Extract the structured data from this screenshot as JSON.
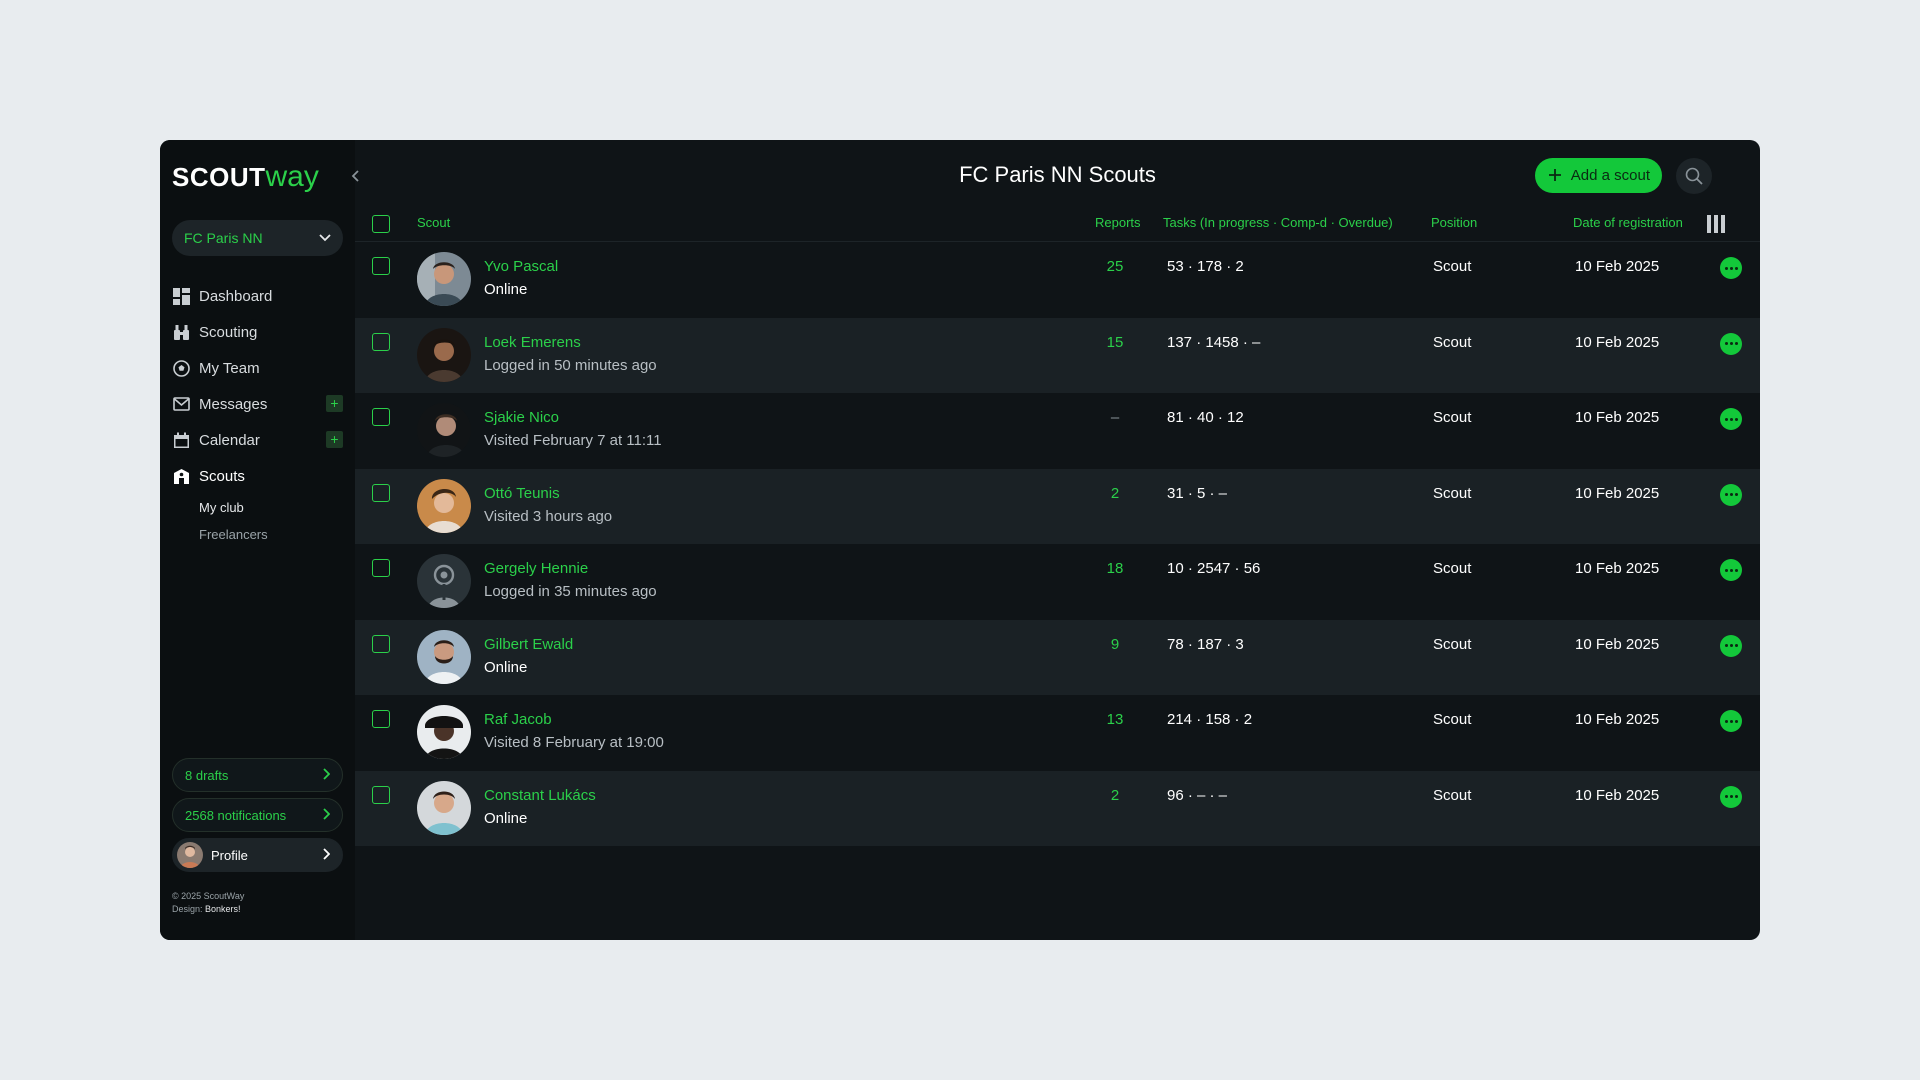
{
  "brand": {
    "logo_main": "SCOUT",
    "logo_accent": "way"
  },
  "sidebar": {
    "club": "FC Paris NN",
    "items": [
      {
        "label": "Dashboard",
        "icon": "dashboard-icon"
      },
      {
        "label": "Scouting",
        "icon": "binoculars-icon"
      },
      {
        "label": "My Team",
        "icon": "soccer-ball-icon"
      },
      {
        "label": "Messages",
        "icon": "envelope-icon"
      },
      {
        "label": "Calendar",
        "icon": "calendar-icon"
      },
      {
        "label": "Scouts",
        "icon": "scout-icon"
      }
    ],
    "sub_items": [
      "My club",
      "Freelancers"
    ],
    "drafts": "8 drafts",
    "notifications": "2568 notifications",
    "profile": "Profile",
    "copyright": "© 2025 ScoutWay",
    "design_label": "Design:",
    "design_by": "Bonkers!"
  },
  "header": {
    "title": "FC Paris NN Scouts",
    "add_button": "Add a scout"
  },
  "table": {
    "columns": {
      "scout": "Scout",
      "reports": "Reports",
      "tasks": "Tasks (In progress · Comp-d · Overdue)",
      "position": "Position",
      "date": "Date of registration"
    },
    "rows": [
      {
        "name": "Yvo Pascal",
        "status": "Online",
        "reports": "25",
        "tasks": "53 · 178 · 2",
        "position": "Scout",
        "date": "10 Feb 2025"
      },
      {
        "name": "Loek Emerens",
        "status": "Logged in 50 minutes ago",
        "reports": "15",
        "tasks": "137 · 1458 · –",
        "position": "Scout",
        "date": "10 Feb 2025"
      },
      {
        "name": "Sjakie Nico",
        "status": "Visited February 7 at 11:11",
        "reports": "–",
        "tasks": "81 · 40 · 12",
        "position": "Scout",
        "date": "10 Feb 2025"
      },
      {
        "name": "Ottó Teunis",
        "status": "Visited 3 hours ago",
        "reports": "2",
        "tasks": "31 · 5 · –",
        "position": "Scout",
        "date": "10 Feb 2025"
      },
      {
        "name": "Gergely Hennie",
        "status": "Logged in 35 minutes ago",
        "reports": "18",
        "tasks": "10 · 2547 · 56",
        "position": "Scout",
        "date": "10 Feb 2025"
      },
      {
        "name": "Gilbert Ewald",
        "status": "Online",
        "reports": "9",
        "tasks": "78 · 187 · 3",
        "position": "Scout",
        "date": "10 Feb 2025"
      },
      {
        "name": "Raf Jacob",
        "status": "Visited 8 February at 19:00",
        "reports": "13",
        "tasks": "214 · 158 · 2",
        "position": "Scout",
        "date": "10 Feb 2025"
      },
      {
        "name": "Constant Lukács",
        "status": "Online",
        "reports": "2",
        "tasks": "96 · – · –",
        "position": "Scout",
        "date": "10 Feb 2025"
      }
    ]
  },
  "colors": {
    "accent": "#2bd04a",
    "button": "#13c83a",
    "background": "#0f1417",
    "sidebar": "#0b0f11",
    "row_alt": "#1a2125"
  }
}
